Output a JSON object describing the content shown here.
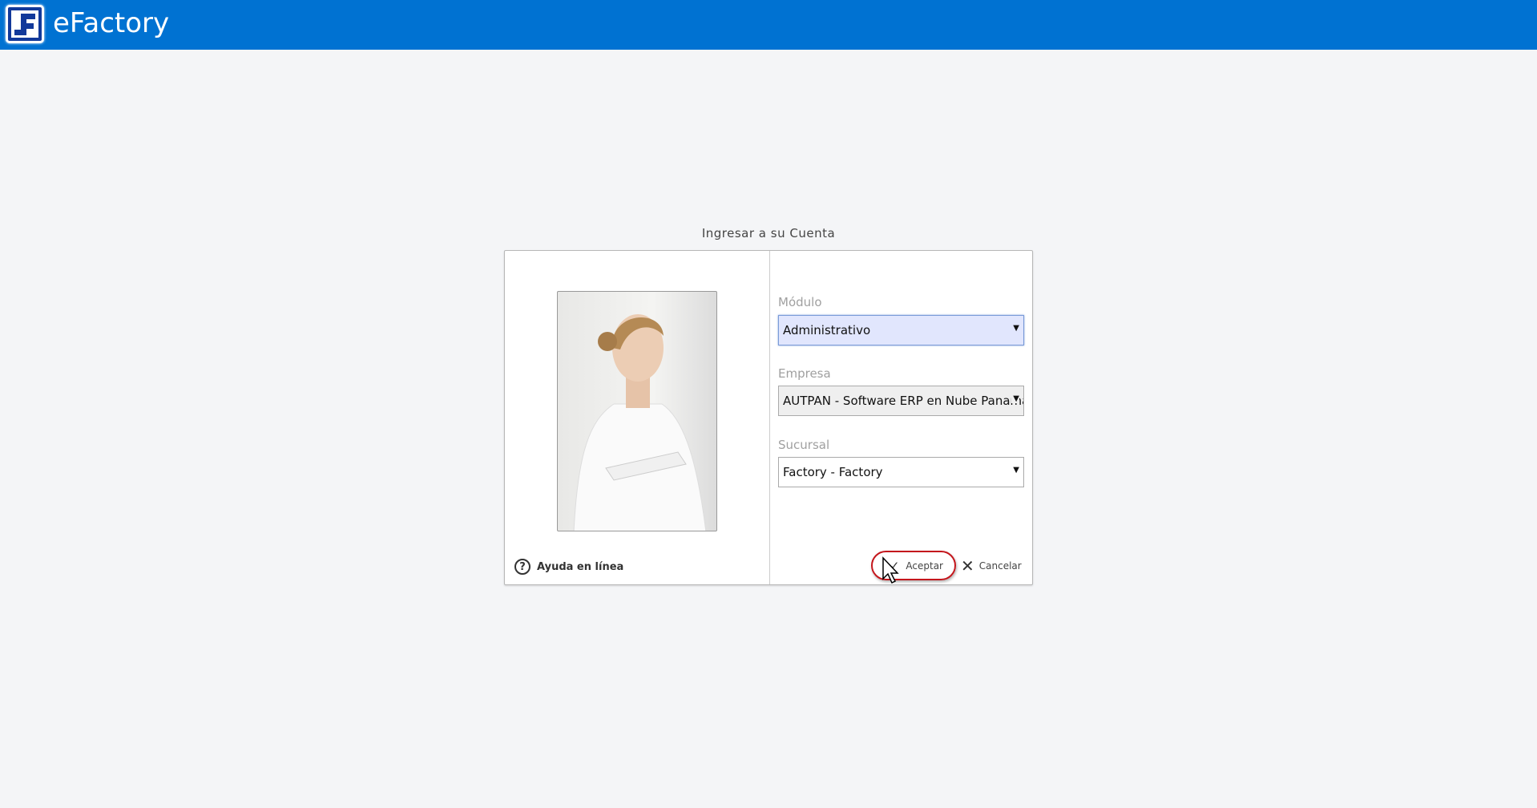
{
  "header": {
    "app_title": "eFactory",
    "logo_letter": "F"
  },
  "login": {
    "title": "Ingresar a su Cuenta",
    "help_label": "Ayuda en línea",
    "fields": [
      {
        "label": "Módulo",
        "value": "Administrativo"
      },
      {
        "label": "Empresa",
        "value": "AUTPAN - Software ERP en Nube Panamá"
      },
      {
        "label": "Sucursal",
        "value": "Factory - Factory"
      }
    ],
    "accept_label": "Aceptar",
    "cancel_label": "Cancelar"
  },
  "colors": {
    "header": "#0072d2",
    "highlight": "#c4161c"
  }
}
